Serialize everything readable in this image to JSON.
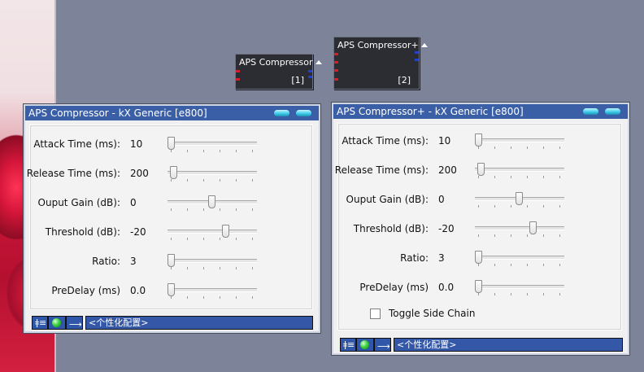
{
  "nodes": [
    {
      "title": "APS Compressor",
      "id": "[1]"
    },
    {
      "title": "APS Compressor+",
      "id": "[2]"
    }
  ],
  "windows": [
    {
      "title": "APS Compressor - kX Generic [e800]",
      "params": [
        {
          "label": "Attack Time (ms):",
          "value": "10",
          "level": 0.0
        },
        {
          "label": "Release Time (ms):",
          "value": "200",
          "level": 0.03
        },
        {
          "label": "Ouput Gain (dB):",
          "value": "0",
          "level": 0.5
        },
        {
          "label": "Threshold (dB):",
          "value": "-20",
          "level": 0.67
        },
        {
          "label": "Ratio:",
          "value": "3",
          "level": 0.0
        },
        {
          "label": "PreDelay (ms)",
          "value": "0.0",
          "level": 0.0
        }
      ],
      "status_text": "<个性化配置>"
    },
    {
      "title": "APS Compressor+ - kX Generic [e800]",
      "params": [
        {
          "label": "Attack Time (ms):",
          "value": "10",
          "level": 0.0
        },
        {
          "label": "Release Time (ms):",
          "value": "200",
          "level": 0.03
        },
        {
          "label": "Ouput Gain (dB):",
          "value": "0",
          "level": 0.5
        },
        {
          "label": "Threshold (dB):",
          "value": "-20",
          "level": 0.67
        },
        {
          "label": "Ratio:",
          "value": "3",
          "level": 0.0
        },
        {
          "label": "PreDelay (ms)",
          "value": "0.0",
          "level": 0.0
        }
      ],
      "toggle": {
        "label": "Toggle Side Chain",
        "checked": false
      },
      "status_text": "<个性化配置>"
    }
  ],
  "icons": [
    "eq-sliders-icon",
    "status-led-icon",
    "arrow-right-icon",
    "minimize-icon",
    "close-icon",
    "collapse-triangle-icon"
  ],
  "colors": {
    "title_bar": "#3b5fa6",
    "desktop": "#7d8499",
    "node_bg": "#2b2d33",
    "led": "#3ed43e"
  }
}
